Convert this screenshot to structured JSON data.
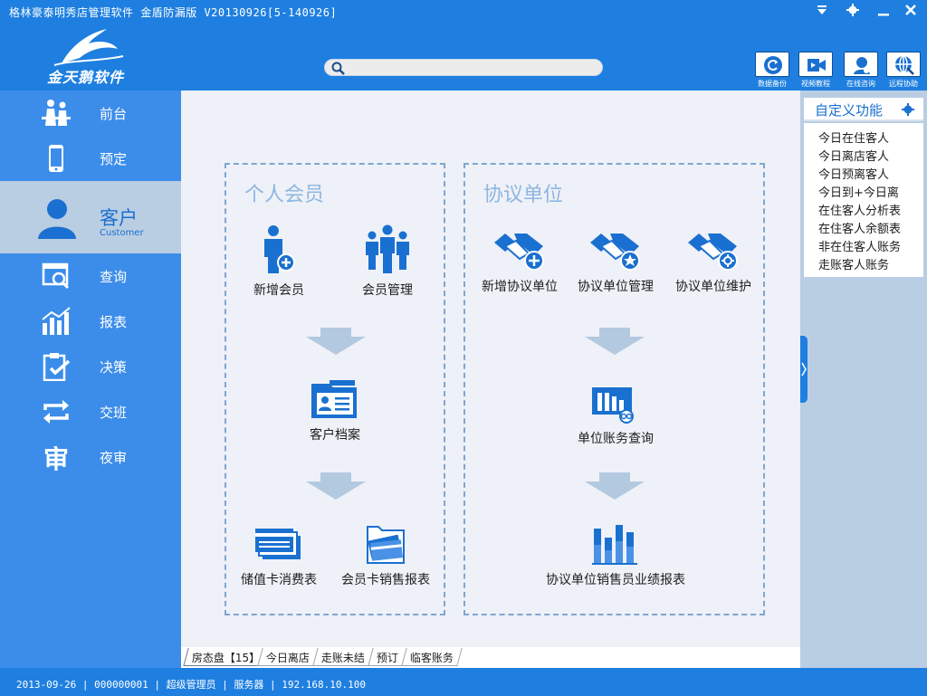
{
  "window": {
    "title": "格林豪泰明秀店管理软件  金盾防漏版  V20130926[5-140926]"
  },
  "brand": {
    "logo_text": "金天鹅软件"
  },
  "search": {
    "placeholder": "",
    "value": ""
  },
  "toolbar": {
    "backup": "数据备份",
    "video": "视频教程",
    "online": "在线咨询",
    "remote": "远程协助"
  },
  "sidebar": {
    "items": [
      {
        "label": "前台",
        "icon": "reception-icon"
      },
      {
        "label": "预定",
        "icon": "phone-icon"
      },
      {
        "label": "客户",
        "sub": "Customer",
        "icon": "customer-icon",
        "active": true
      },
      {
        "label": "查询",
        "icon": "query-icon"
      },
      {
        "label": "报表",
        "icon": "report-icon"
      },
      {
        "label": "决策",
        "icon": "decision-icon"
      },
      {
        "label": "交班",
        "icon": "shift-icon"
      },
      {
        "label": "夜审",
        "icon": "night-audit-icon"
      }
    ]
  },
  "main": {
    "personal": {
      "title": "个人会员",
      "new_member": "新增会员",
      "member_manage": "会员管理",
      "customer_file": "客户档案",
      "stored_card": "储值卡消费表",
      "card_sales": "会员卡销售报表"
    },
    "agreement": {
      "title": "协议单位",
      "new_unit": "新增协议单位",
      "unit_manage": "协议单位管理",
      "unit_maintain": "协议单位维护",
      "account_query": "单位账务查询",
      "sales_report": "协议单位销售员业绩报表"
    }
  },
  "right_panel": {
    "title": "自定义功能",
    "items": [
      "今日在住客人",
      "今日离店客人",
      "今日预离客人",
      "今日到+今日离",
      "在住客人分析表",
      "在住客人余额表",
      "非在住客人账务",
      "走账客人账务"
    ]
  },
  "tabs": [
    {
      "label": "房态盘【15】",
      "active": true
    },
    {
      "label": "今日离店"
    },
    {
      "label": "走账未结"
    },
    {
      "label": "预订"
    },
    {
      "label": "临客账务"
    }
  ],
  "status": {
    "text": "2013-09-26 | 000000001 | 超级管理员 | 服务器 | 192.168.10.100"
  },
  "colors": {
    "header": "#1e7fe0",
    "sidebar": "#3c8dea",
    "active_nav": "#b9cde3",
    "icon_blue": "#1a70d0"
  }
}
